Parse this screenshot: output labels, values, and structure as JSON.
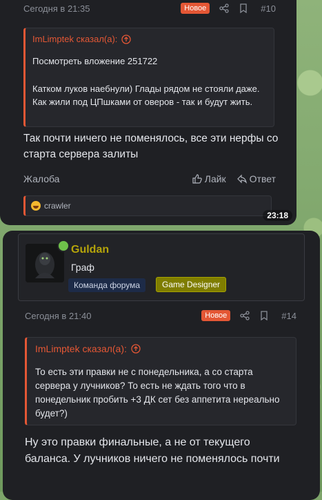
{
  "post1": {
    "time": "Сегодня в 21:35",
    "new_badge": "Новое",
    "post_number": "#10",
    "quote": {
      "author": "ImLimptek сказал(а):",
      "attachment": "Посмотреть вложение 251722",
      "text": "Катком луков наебнули) Глады рядом не стояли даже. Как жили под ЦПшками от оверов - так и будут жить."
    },
    "message": "Так почти ничего не поменялось, все эти нерфы со старта сервера залиты",
    "report": "Жалоба",
    "like": "Лайк",
    "reply": "Ответ",
    "reaction_user": "crawler",
    "timestamp": "23:18"
  },
  "post2": {
    "username": "Guldan",
    "rank": "Граф",
    "tags": [
      "Команда форума",
      "Game Designer"
    ],
    "time": "Сегодня в 21:40",
    "new_badge": "Новое",
    "post_number": "#14",
    "quote": {
      "author": "ImLimptek сказал(а):",
      "text": "То есть эти правки не с понедельника, а со старта сервера у лучников? То есть не ждать того что в понедельник пробить +3 ДК сет без аппетита нереально будет?)"
    },
    "message": "Ну это правки финальные, а не от текущего баланса. У лучников ничего не поменялось почти"
  },
  "colors": {
    "accent": "#e45735",
    "username": "#b5a40a",
    "tag1_bg": "#1d2b48",
    "tag2_bg": "#7f7d00"
  }
}
